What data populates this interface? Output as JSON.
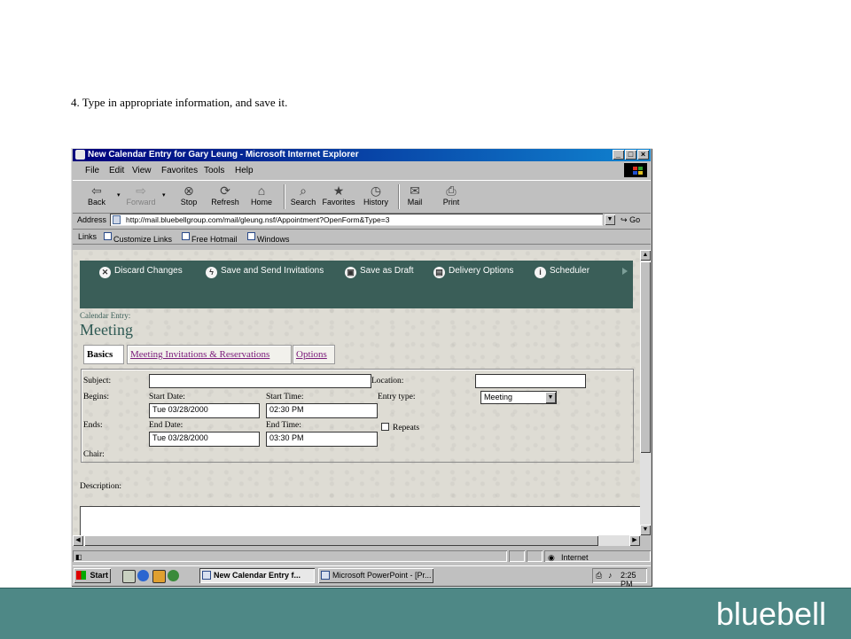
{
  "instruction": "4.  Type in appropriate information, and save it.",
  "window": {
    "title": "New Calendar Entry for Gary Leung - Microsoft Internet Explorer",
    "controls": {
      "minimize": "_",
      "maximize": "□",
      "close": "×"
    }
  },
  "menu": [
    "File",
    "Edit",
    "View",
    "Favorites",
    "Tools",
    "Help"
  ],
  "toolbar": {
    "back": "Back",
    "forward": "Forward",
    "stop": "Stop",
    "refresh": "Refresh",
    "home": "Home",
    "search": "Search",
    "favorites": "Favorites",
    "history": "History",
    "mail": "Mail",
    "print": "Print"
  },
  "address": {
    "label": "Address",
    "url": "http://mail.bluebellgroup.com/mail/gleung.nsf/Appointment?OpenForm&Type=3",
    "go": "Go"
  },
  "links": {
    "label": "Links",
    "items": [
      "Customize Links",
      "Free Hotmail",
      "Windows"
    ]
  },
  "actions": [
    "Discard Changes",
    "Save and Send Invitations",
    "Save as Draft",
    "Delivery Options",
    "Scheduler"
  ],
  "entry": {
    "kicker": "Calendar Entry:",
    "title": "Meeting"
  },
  "tabs": [
    "Basics",
    "Meeting Invitations & Reservations",
    "Options"
  ],
  "form": {
    "subject_label": "Subject:",
    "subject_value": "",
    "location_label": "Location:",
    "location_value": "",
    "begins_label": "Begins:",
    "ends_label": "Ends:",
    "chair_label": "Chair:",
    "start_date_label": "Start Date:",
    "start_date": "Tue 03/28/2000",
    "start_time_label": "Start Time:",
    "start_time": "02:30 PM",
    "end_date_label": "End Date:",
    "end_date": "Tue 03/28/2000",
    "end_time_label": "End Time:",
    "end_time": "03:30 PM",
    "entry_type_label": "Entry type:",
    "entry_type": "Meeting",
    "repeats_label": "Repeats",
    "repeats_checked": false
  },
  "description_label": "Description:",
  "status": {
    "zone": "Internet"
  },
  "taskbar": {
    "start": "Start",
    "tasks": [
      "New Calendar Entry f...",
      "Microsoft PowerPoint - [Pr..."
    ],
    "clock": "2:25 PM"
  },
  "brand": "bluebell",
  "colors": {
    "brand_footer": "#4e8886",
    "action_bar": "#3a5e58",
    "titlebar": "#00007b"
  }
}
